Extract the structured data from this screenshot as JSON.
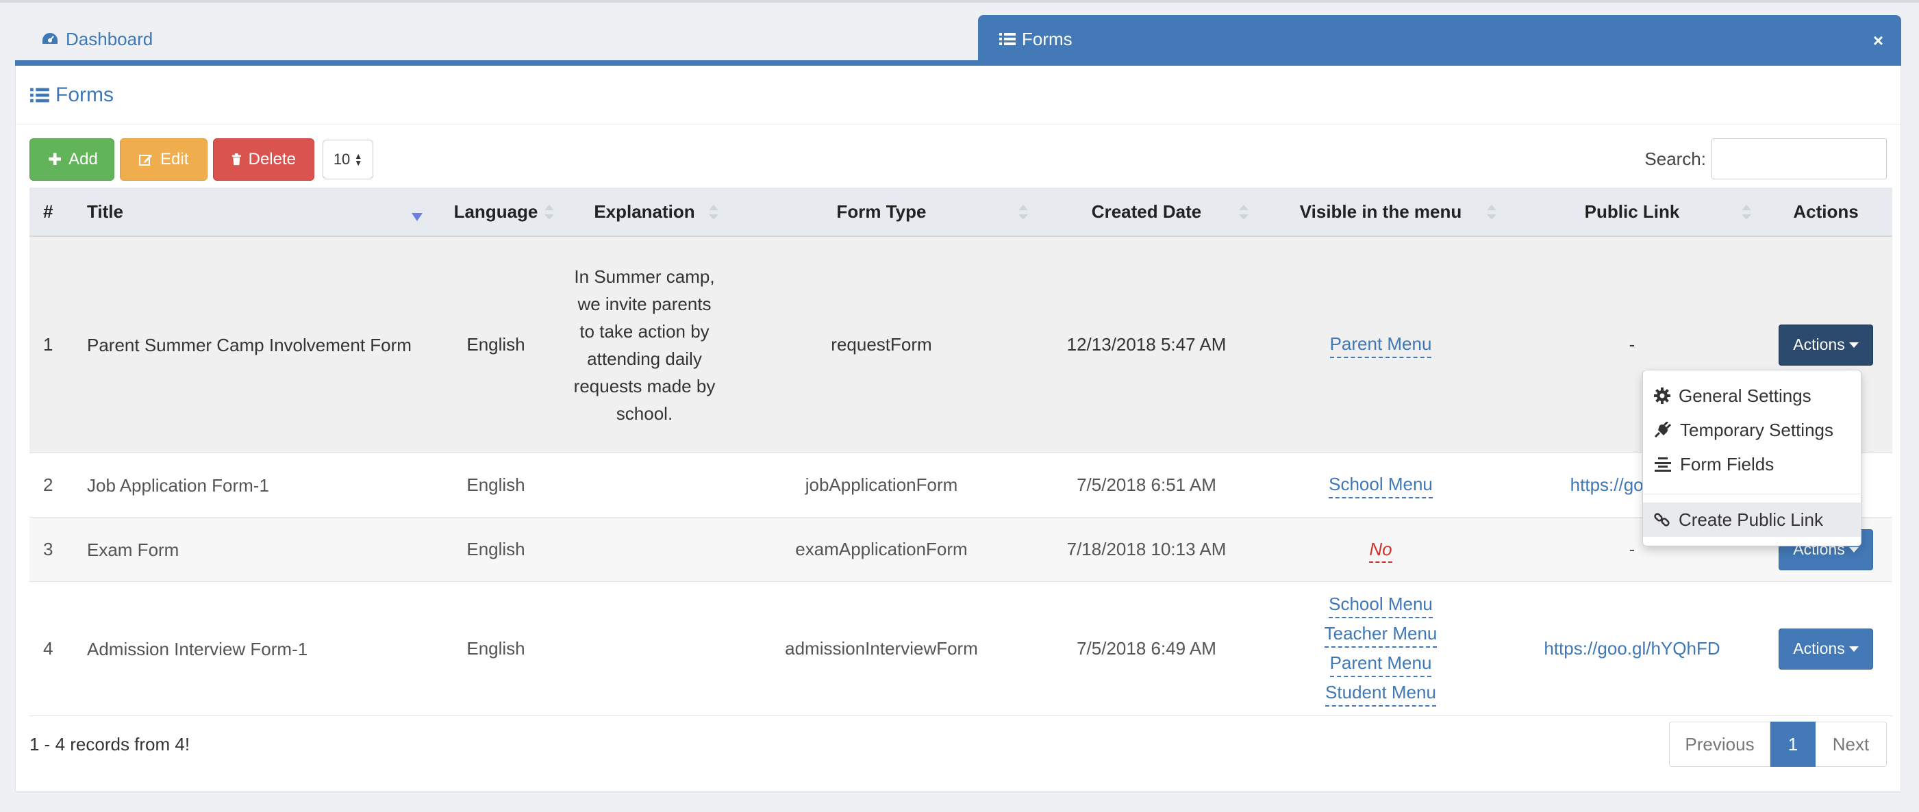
{
  "tabs": {
    "dashboard": "Dashboard",
    "forms": "Forms",
    "close": "×"
  },
  "panel": {
    "title": "Forms"
  },
  "toolbar": {
    "add": "Add",
    "edit": "Edit",
    "delete": "Delete",
    "page_size": "10"
  },
  "search": {
    "label": "Search:",
    "value": ""
  },
  "table": {
    "headers": {
      "num": "#",
      "title": "Title",
      "language": "Language",
      "explanation": "Explanation",
      "form_type": "Form Type",
      "created": "Created Date",
      "visible": "Visible in the menu",
      "public_link": "Public Link",
      "actions": "Actions"
    },
    "rows": [
      {
        "num": "1",
        "title": "Parent Summer Camp Involvement Form",
        "language": "English",
        "explanation": "In Summer camp, we invite parents to take action by attending daily requests made by school.",
        "form_type": "requestForm",
        "created": "12/13/2018 5:47 AM",
        "visible": [
          "Parent Menu"
        ],
        "public_link": "-",
        "action": "Actions"
      },
      {
        "num": "2",
        "title": "Job Application Form-1",
        "language": "English",
        "explanation": "",
        "form_type": "jobApplicationForm",
        "created": "7/5/2018 6:51 AM",
        "visible": [
          "School Menu"
        ],
        "public_link": "https://goo.gl/W",
        "action": "Actions"
      },
      {
        "num": "3",
        "title": "Exam Form",
        "language": "English",
        "explanation": "",
        "form_type": "examApplicationForm",
        "created": "7/18/2018 10:13 AM",
        "visible_no": "No",
        "public_link": "-",
        "action": "Actions"
      },
      {
        "num": "4",
        "title": "Admission Interview Form-1",
        "language": "English",
        "explanation": "",
        "form_type": "admissionInterviewForm",
        "created": "7/5/2018 6:49 AM",
        "visible": [
          "School Menu",
          "Teacher Menu",
          "Parent Menu",
          "Student Menu"
        ],
        "public_link": "https://goo.gl/hYQhFD",
        "action": "Actions"
      }
    ]
  },
  "dropdown": {
    "items": [
      "General Settings",
      "Temporary Settings",
      "Form Fields",
      "Create Public Link"
    ]
  },
  "footer": {
    "records": "1 - 4 records from 4!",
    "prev": "Previous",
    "page": "1",
    "next": "Next"
  },
  "colors": {
    "primary": "#4279b6",
    "success": "#62b45a",
    "warning": "#f0ad4e",
    "danger": "#d9534f"
  }
}
